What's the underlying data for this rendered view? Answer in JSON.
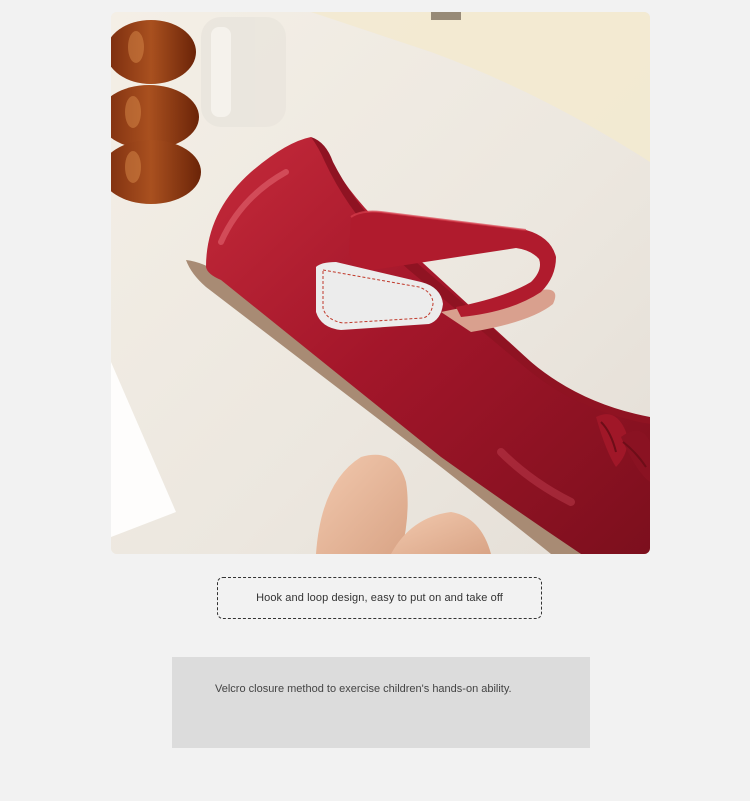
{
  "photo": {
    "alt": "Red patent leather children's shoe with hook and loop strap"
  },
  "caption": {
    "text": "Hook and loop design, easy to put on and take off"
  },
  "description": {
    "text": "Velcro closure method to exercise children's hands-on ability."
  },
  "colors": {
    "background": "#f2f2f2",
    "shoe_red": "#a3162a",
    "desc_box": "#dcdcdc",
    "caption_border": "#333333"
  }
}
